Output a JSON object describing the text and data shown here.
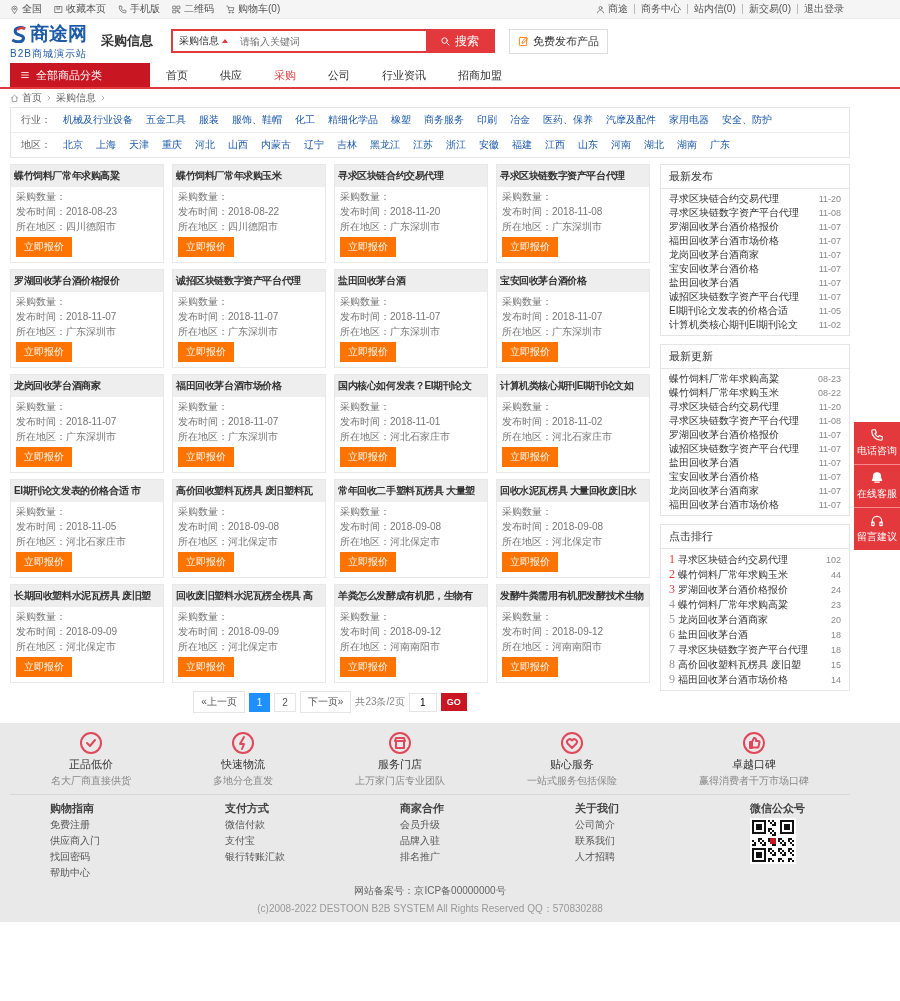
{
  "top_bar": {
    "left": [
      "全国",
      "收藏本页",
      "手机版",
      "二维码",
      "购物车(0)"
    ],
    "right": [
      "商途",
      "商务中心",
      "站内信(0)",
      "新交易(0)",
      "退出登录"
    ]
  },
  "header": {
    "logo": "商途网",
    "logo_sub": "B2B商城演示站",
    "section": "采购信息",
    "search": {
      "scope": "采购信息",
      "placeholder": "请输入关键词",
      "button": "搜索"
    },
    "publish_button": "免费发布产品"
  },
  "nav": {
    "category": "全部商品分类",
    "items": [
      {
        "label": "首页",
        "selected": false
      },
      {
        "label": "供应",
        "selected": false
      },
      {
        "label": "采购",
        "selected": true
      },
      {
        "label": "公司",
        "selected": false
      },
      {
        "label": "行业资讯",
        "selected": false
      },
      {
        "label": "招商加盟",
        "selected": false
      }
    ]
  },
  "breadcrumb": [
    "首页",
    "采购信息"
  ],
  "filters": [
    {
      "label": "行业：",
      "options": [
        "机械及行业设备",
        "五金工具",
        "服装",
        "服饰、鞋帽",
        "化工",
        "精细化学品",
        "橡塑",
        "商务服务",
        "印刷",
        "冶金",
        "医药、保养",
        "汽摩及配件",
        "家用电器",
        "安全、防护"
      ]
    },
    {
      "label": "地区：",
      "options": [
        "北京",
        "上海",
        "天津",
        "重庆",
        "河北",
        "山西",
        "内蒙古",
        "辽宁",
        "吉林",
        "黑龙江",
        "江苏",
        "浙江",
        "安徽",
        "福建",
        "江西",
        "山东",
        "河南",
        "湖北",
        "湖南",
        "广东"
      ]
    }
  ],
  "cards": [
    {
      "title": "蝶竹饲料厂常年求购高粱",
      "quantity": "采购数量：",
      "date": "发布时间：2018-08-23",
      "area": "所在地区：四川德阳市",
      "button": "立即报价"
    },
    {
      "title": "蝶竹饲料厂常年求购玉米",
      "quantity": "采购数量：",
      "date": "发布时间：2018-08-22",
      "area": "所在地区：四川德阳市",
      "button": "立即报价"
    },
    {
      "title": "寻求区块链合约交易代理",
      "quantity": "采购数量：",
      "date": "发布时间：2018-11-20",
      "area": "所在地区：广东深圳市",
      "button": "立即报价"
    },
    {
      "title": "寻求区块链数字资产平台代理",
      "quantity": "采购数量：",
      "date": "发布时间：2018-11-08",
      "area": "所在地区：广东深圳市",
      "button": "立即报价"
    },
    {
      "title": "罗湖回收茅台酒价格报价",
      "quantity": "采购数量：",
      "date": "发布时间：2018-11-07",
      "area": "所在地区：广东深圳市",
      "button": "立即报价"
    },
    {
      "title": "诚招区块链数字资产平台代理",
      "quantity": "采购数量：",
      "date": "发布时间：2018-11-07",
      "area": "所在地区：广东深圳市",
      "button": "立即报价"
    },
    {
      "title": "盐田回收茅台酒",
      "quantity": "采购数量：",
      "date": "发布时间：2018-11-07",
      "area": "所在地区：广东深圳市",
      "button": "立即报价"
    },
    {
      "title": "宝安回收茅台酒价格",
      "quantity": "采购数量：",
      "date": "发布时间：2018-11-07",
      "area": "所在地区：广东深圳市",
      "button": "立即报价"
    },
    {
      "title": "龙岗回收茅台酒商家",
      "quantity": "采购数量：",
      "date": "发布时间：2018-11-07",
      "area": "所在地区：广东深圳市",
      "button": "立即报价"
    },
    {
      "title": "福田回收茅台酒市场价格",
      "quantity": "采购数量：",
      "date": "发布时间：2018-11-07",
      "area": "所在地区：广东深圳市",
      "button": "立即报价"
    },
    {
      "title": "国内核心如何发表？EI期刊论文",
      "quantity": "采购数量：",
      "date": "发布时间：2018-11-01",
      "area": "所在地区：河北石家庄市",
      "button": "立即报价"
    },
    {
      "title": "计算机类核心期刊EI期刊论文如",
      "quantity": "采购数量：",
      "date": "发布时间：2018-11-02",
      "area": "所在地区：河北石家庄市",
      "button": "立即报价"
    },
    {
      "title": "EI期刊论文发表的价格合适 市",
      "quantity": "采购数量：",
      "date": "发布时间：2018-11-05",
      "area": "所在地区：河北石家庄市",
      "button": "立即报价"
    },
    {
      "title": "高价回收塑料瓦楞具 废旧塑料瓦",
      "quantity": "采购数量：",
      "date": "发布时间：2018-09-08",
      "area": "所在地区：河北保定市",
      "button": "立即报价"
    },
    {
      "title": "常年回收二手塑料瓦楞具 大量塑",
      "quantity": "采购数量：",
      "date": "发布时间：2018-09-08",
      "area": "所在地区：河北保定市",
      "button": "立即报价"
    },
    {
      "title": "回收水泥瓦楞具 大量回收废旧水",
      "quantity": "采购数量：",
      "date": "发布时间：2018-09-08",
      "area": "所在地区：河北保定市",
      "button": "立即报价"
    },
    {
      "title": "长期回收塑料水泥瓦楞具 废旧塑",
      "quantity": "采购数量：",
      "date": "发布时间：2018-09-09",
      "area": "所在地区：河北保定市",
      "button": "立即报价"
    },
    {
      "title": "回收废旧塑料水泥瓦楞全楞具 高",
      "quantity": "采购数量：",
      "date": "发布时间：2018-09-09",
      "area": "所在地区：河北保定市",
      "button": "立即报价"
    },
    {
      "title": "羊粪怎么发酵成有机肥，生物有",
      "quantity": "采购数量：",
      "date": "发布时间：2018-09-12",
      "area": "所在地区：河南南阳市",
      "button": "立即报价"
    },
    {
      "title": "发酵牛粪需用有机肥发酵技术生物",
      "quantity": "采购数量：",
      "date": "发布时间：2018-09-12",
      "area": "所在地区：河南南阳市",
      "button": "立即报价"
    }
  ],
  "pagination": {
    "prev": "«上一页",
    "pages": [
      {
        "label": "1",
        "selected": true
      },
      {
        "label": "2",
        "selected": false
      }
    ],
    "next": "下一页»",
    "summary": "共23条/2页",
    "page_input": "1",
    "go": "GO"
  },
  "sidebar": [
    {
      "title": "最新发布",
      "kind": "dated",
      "items": [
        {
          "text": "寻求区块链合约交易代理",
          "meta": "11-20"
        },
        {
          "text": "寻求区块链数字资产平台代理",
          "meta": "11-08"
        },
        {
          "text": "罗湖回收茅台酒价格报价",
          "meta": "11-07"
        },
        {
          "text": "福田回收茅台酒市场价格",
          "meta": "11-07"
        },
        {
          "text": "龙岗回收茅台酒商家",
          "meta": "11-07"
        },
        {
          "text": "宝安回收茅台酒价格",
          "meta": "11-07"
        },
        {
          "text": "盐田回收茅台酒",
          "meta": "11-07"
        },
        {
          "text": "诚招区块链数字资产平台代理",
          "meta": "11-07"
        },
        {
          "text": "EI期刊论文发表的价格合适",
          "meta": "11-05"
        },
        {
          "text": "计算机类核心期刊EI期刊论文",
          "meta": "11-02"
        }
      ]
    },
    {
      "title": "最新更新",
      "kind": "dated",
      "items": [
        {
          "text": "蝶竹饲料厂常年求购高粱",
          "meta": "08-23"
        },
        {
          "text": "蝶竹饲料厂常年求购玉米",
          "meta": "08-22"
        },
        {
          "text": "寻求区块链合约交易代理",
          "meta": "11-20"
        },
        {
          "text": "寻求区块链数字资产平台代理",
          "meta": "11-08"
        },
        {
          "text": "罗湖回收茅台酒价格报价",
          "meta": "11-07"
        },
        {
          "text": "诚招区块链数字资产平台代理",
          "meta": "11-07"
        },
        {
          "text": "盐田回收茅台酒",
          "meta": "11-07"
        },
        {
          "text": "宝安回收茅台酒价格",
          "meta": "11-07"
        },
        {
          "text": "龙岗回收茅台酒商家",
          "meta": "11-07"
        },
        {
          "text": "福田回收茅台酒市场价格",
          "meta": "11-07"
        }
      ]
    },
    {
      "title": "点击排行",
      "kind": "ranked",
      "items": [
        {
          "rank": "1",
          "top": true,
          "text": "寻求区块链合约交易代理",
          "meta": "102"
        },
        {
          "rank": "2",
          "top": true,
          "text": "蝶竹饲料厂常年求购玉米",
          "meta": "44"
        },
        {
          "rank": "3",
          "top": true,
          "text": "罗湖回收茅台酒价格报价",
          "meta": "24"
        },
        {
          "rank": "4",
          "top": false,
          "text": "蝶竹饲料厂常年求购高粱",
          "meta": "23"
        },
        {
          "rank": "5",
          "top": false,
          "text": "龙岗回收茅台酒商家",
          "meta": "20"
        },
        {
          "rank": "6",
          "top": false,
          "text": "盐田回收茅台酒",
          "meta": "18"
        },
        {
          "rank": "7",
          "top": false,
          "text": "寻求区块链数字资产平台代理",
          "meta": "18"
        },
        {
          "rank": "8",
          "top": false,
          "text": "高价回收塑料瓦楞具 废旧塑",
          "meta": "15"
        },
        {
          "rank": "9",
          "top": false,
          "text": "福田回收茅台酒市场价格",
          "meta": "14"
        }
      ]
    }
  ],
  "float_buttons": [
    "电话咨询",
    "在线客服",
    "留言建议"
  ],
  "features": [
    {
      "title": "正品低价",
      "subtitle": "名大厂商直接供货"
    },
    {
      "title": "快速物流",
      "subtitle": "多地分仓直发"
    },
    {
      "title": "服务门店",
      "subtitle": "上万家门店专业团队"
    },
    {
      "title": "贴心服务",
      "subtitle": "一站式服务包括保险"
    },
    {
      "title": "卓越口碑",
      "subtitle": "赢得消费者千万市场口碑"
    }
  ],
  "footer_columns": [
    {
      "title": "购物指南",
      "links": [
        "免费注册",
        "供应商入门",
        "找回密码",
        "帮助中心"
      ]
    },
    {
      "title": "支付方式",
      "links": [
        "微信付款",
        "支付宝",
        "银行转账汇款"
      ]
    },
    {
      "title": "商家合作",
      "links": [
        "会员升级",
        "品牌入驻",
        "排名推广"
      ]
    },
    {
      "title": "关于我们",
      "links": [
        "公司简介",
        "联系我们",
        "人才招聘"
      ]
    }
  ],
  "wechat": {
    "title": "微信公众号"
  },
  "icp": "网站备案号：京ICP备00000000号",
  "copyright": "(c)2008-2022 DESTOON B2B SYSTEM All Rights Reserved QQ：570830288"
}
